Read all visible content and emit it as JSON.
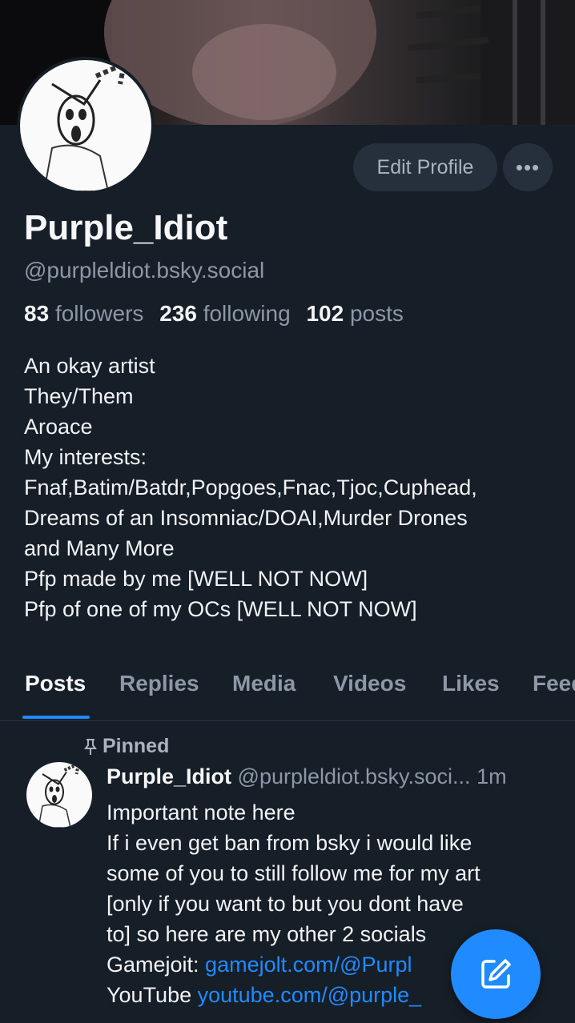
{
  "profile": {
    "display_name": "Purple_Idiot",
    "handle": "@purpleldiot.bsky.social",
    "followers_count": "83",
    "followers_label": "followers",
    "following_count": "236",
    "following_label": "following",
    "posts_count": "102",
    "posts_label": "posts",
    "edit_label": "Edit Profile",
    "more_label": "•••",
    "bio": [
      "An okay artist",
      "They/Them",
      "Aroace",
      "My interests:",
      "Fnaf,Batim/Batdr,Popgoes,Fnac,Tjoc,Cuphead,",
      "Dreams of an Insomniac/DOAI,Murder Drones",
      "and Many More",
      "Pfp made by me [WELL NOT NOW]",
      "Pfp of one of my OCs [WELL NOT NOW]"
    ]
  },
  "tabs": [
    "Posts",
    "Replies",
    "Media",
    "Videos",
    "Likes",
    "Feeds"
  ],
  "pinned_post": {
    "pinned_label": "Pinned",
    "author": "Purple_Idiot",
    "handle": "@purpleldiot.bsky.soci...",
    "time": "1m",
    "lines": [
      "Important note here",
      "If i even get ban from bsky i would like",
      "some of you to still follow me for my art",
      "[only if you want to but you dont have",
      "to] so here are my  other 2 socials"
    ],
    "gamejolt_label": "Gamejoit: ",
    "gamejolt_link": "gamejolt.com/@Purpl",
    "youtube_label": "YouTube ",
    "youtube_link": "youtube.com/@purple_"
  },
  "icons": {
    "more": "ellipsis-icon",
    "pin": "pin-icon",
    "compose": "compose-icon"
  },
  "colors": {
    "background": "#161e27",
    "accent": "#208bfe",
    "muted": "#8d98a6"
  }
}
